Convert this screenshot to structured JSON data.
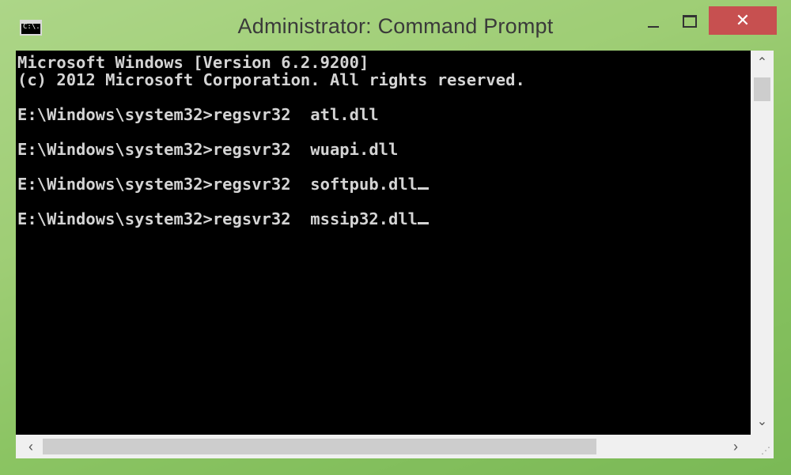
{
  "window": {
    "title": "Administrator: Command Prompt",
    "icon_text": "C:\\."
  },
  "controls": {
    "close_glyph": "✕"
  },
  "console": {
    "lines": [
      "Microsoft Windows [Version 6.2.9200]",
      "(c) 2012 Microsoft Corporation. All rights reserved.",
      "",
      "E:\\Windows\\system32>regsvr32  atl.dll",
      "",
      "E:\\Windows\\system32>regsvr32  wuapi.dll",
      "",
      "E:\\Windows\\system32>regsvr32  softpub.dll",
      "",
      "E:\\Windows\\system32>regsvr32  mssip32.dll"
    ]
  },
  "scrollbars": {
    "up_glyph": "⌃",
    "down_glyph": "⌄",
    "left_glyph": "‹",
    "right_glyph": "›"
  },
  "colors": {
    "console_bg": "#000000",
    "console_text": "#d4d4d4",
    "close_button": "#c75050"
  }
}
